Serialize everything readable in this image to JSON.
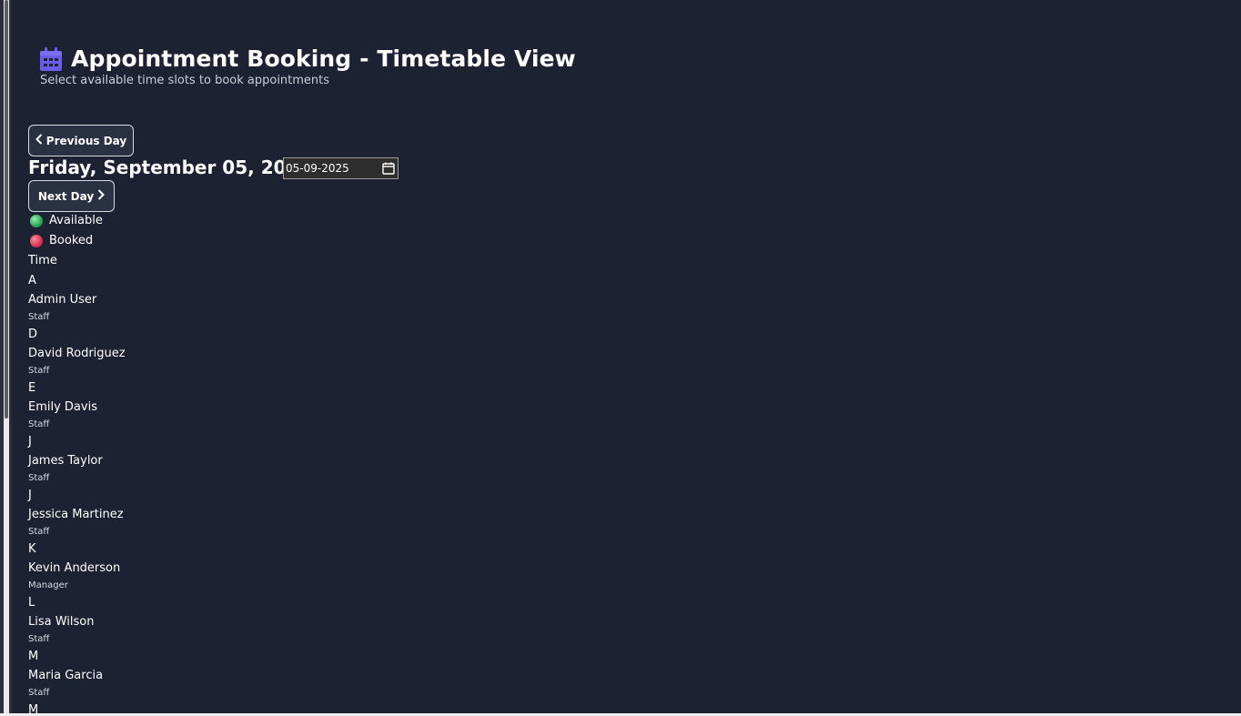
{
  "header": {
    "title": "Appointment Booking - Timetable View",
    "subtitle": "Select available time slots to book appointments",
    "icon": "calendar-icon"
  },
  "navigation": {
    "previous_label": "Previous Day",
    "next_label": "Next Day",
    "current_date": "Friday, September 05, 2025",
    "date_input_value": "05-09-2025"
  },
  "legend": {
    "available_label": "Available",
    "booked_label": "Booked",
    "available_color": "#2fa55a",
    "booked_color": "#d63350"
  },
  "timetable": {
    "time_header": "Time",
    "staff": [
      {
        "initial": "A",
        "name": "Admin User",
        "role": "Staff"
      },
      {
        "initial": "D",
        "name": "David Rodriguez",
        "role": "Staff"
      },
      {
        "initial": "E",
        "name": "Emily Davis",
        "role": "Staff"
      },
      {
        "initial": "J",
        "name": "James Taylor",
        "role": "Staff"
      },
      {
        "initial": "J",
        "name": "Jessica Martinez",
        "role": "Staff"
      },
      {
        "initial": "K",
        "name": "Kevin Anderson",
        "role": "Manager"
      },
      {
        "initial": "L",
        "name": "Lisa Wilson",
        "role": "Staff"
      },
      {
        "initial": "M",
        "name": "Maria Garcia",
        "role": "Staff"
      },
      {
        "initial": "M",
        "name": "",
        "role": ""
      }
    ]
  },
  "theme": {
    "background": "#1c2232",
    "accent": "#6c5ce7"
  }
}
